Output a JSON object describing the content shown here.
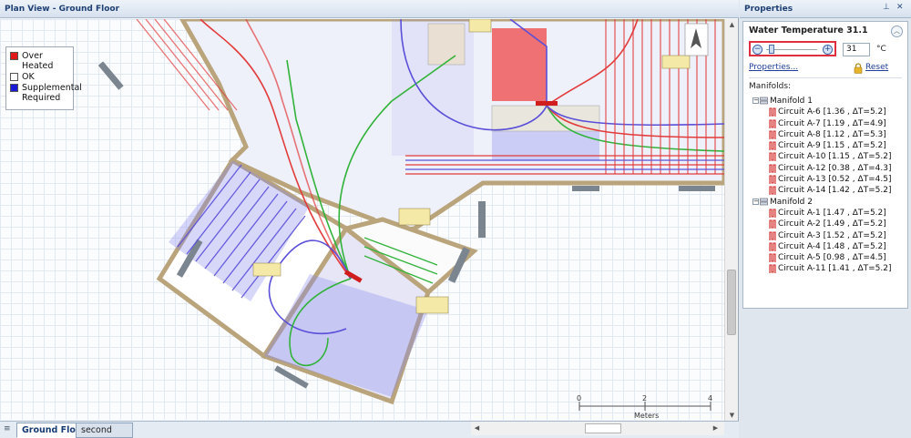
{
  "plan_view": {
    "title": "Plan View - Ground Floor",
    "legend": [
      {
        "label": "Over Heated",
        "color": "#e01818"
      },
      {
        "label": "OK",
        "color": "#ffffff"
      },
      {
        "label": "Supplemental Required",
        "color": "#1a1ad6"
      }
    ],
    "scale_bar": {
      "ticks": [
        "0",
        "2",
        "4"
      ],
      "unit_label": "Meters"
    },
    "tabs": [
      {
        "label": "Ground Floor",
        "active": true
      },
      {
        "label": "second floor",
        "active": false
      }
    ]
  },
  "properties": {
    "title": "Properties",
    "section_title": "Water Temperature 31.1",
    "temperature_value": "31",
    "temperature_unit": "°C",
    "properties_link": "Properties...",
    "reset_link": "Reset",
    "manifolds_label": "Manifolds:",
    "manifolds": [
      {
        "name": "Manifold 1",
        "circuits": [
          "Circuit A-6 [1.36 , ΔT=5.2]",
          "Circuit A-7 [1.19 , ΔT=4.9]",
          "Circuit A-8 [1.12 , ΔT=5.3]",
          "Circuit A-9 [1.15 , ΔT=5.2]",
          "Circuit A-10 [1.15 , ΔT=5.2]",
          "Circuit A-12 [0.38 , ΔT=4.3]",
          "Circuit A-13 [0.52 , ΔT=4.5]",
          "Circuit A-14 [1.42 , ΔT=5.2]"
        ]
      },
      {
        "name": "Manifold 2",
        "circuits": [
          "Circuit A-1 [1.47 , ΔT=5.2]",
          "Circuit A-2 [1.49 , ΔT=5.2]",
          "Circuit A-3 [1.52 , ΔT=5.2]",
          "Circuit A-4 [1.48 , ΔT=5.2]",
          "Circuit A-5 [0.98 , ΔT=4.5]",
          "Circuit A-11 [1.41 , ΔT=5.2]"
        ]
      }
    ]
  },
  "icons": {
    "pin": "pin-icon",
    "close": "close-icon",
    "collapse": "chevron-up-icon",
    "lock": "lock-icon",
    "manifold": "manifold-icon",
    "circuit": "circuit-coil-icon"
  }
}
